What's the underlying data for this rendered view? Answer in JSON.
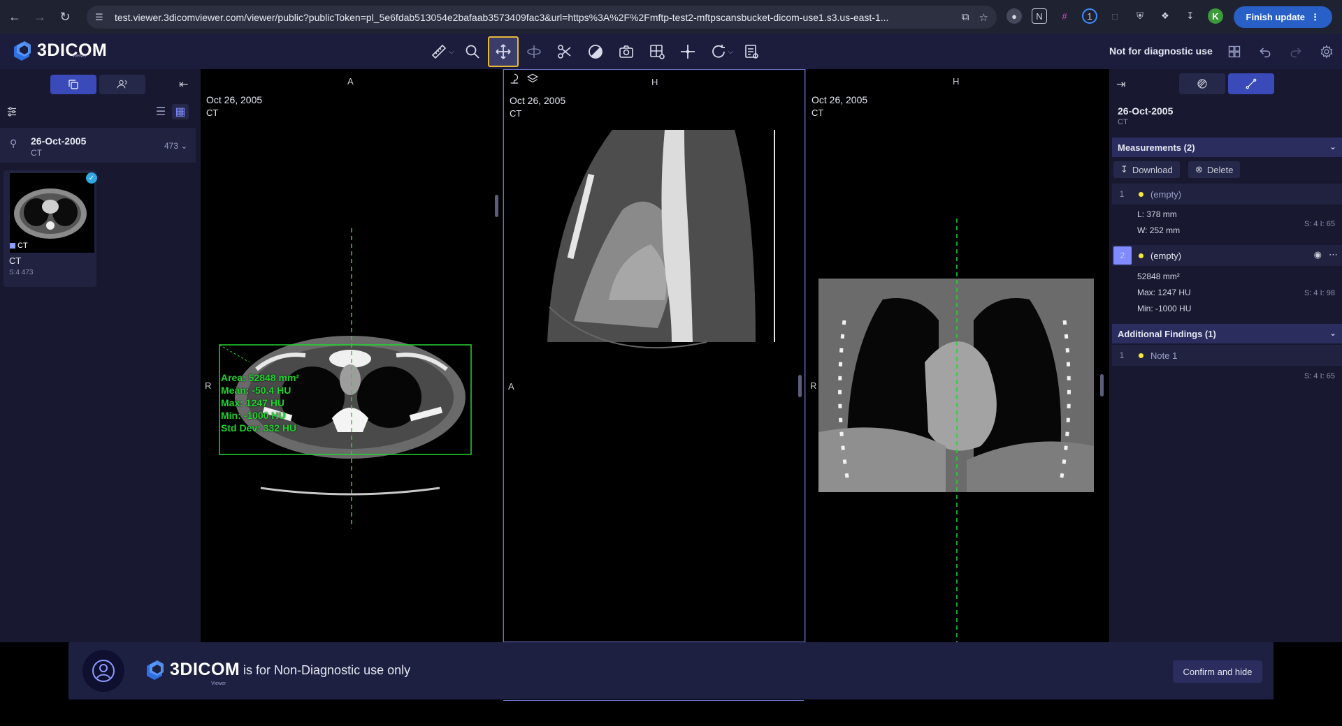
{
  "browser": {
    "url": "test.viewer.3dicomviewer.com/viewer/public?publicToken=pl_5e6fdab513054e2bafaab3573409fac3&url=https%3A%2F%2Fmftp-test2-mftpscansbucket-dicom-use1.s3.us-east-1...",
    "profile_initial": "K",
    "finish_update_label": "Finish update"
  },
  "app": {
    "logo_text": "3DICOM",
    "logo_sub": "Viewer",
    "diagnostic_notice": "Not for diagnostic use",
    "accent_color": "#3a4ab8",
    "active_tool": "pan-tool"
  },
  "left_panel": {
    "study": {
      "date": "26-Oct-2005",
      "modality": "CT",
      "count": "473"
    },
    "series": {
      "tag": "CT",
      "name": "CT",
      "meta": "S:4   473"
    }
  },
  "viewports": [
    {
      "orient_top": "A",
      "orient_left": "R",
      "date": "Oct 26, 2005",
      "modality": "CT",
      "roi": {
        "area": "Area: 52848 mm²",
        "mean": "Mean: -50.4 HU",
        "max": "Max: 1247 HU",
        "min": "Min: -1000 HU",
        "std": "Std Dev: 332 HU"
      }
    },
    {
      "orient_top": "H",
      "orient_left": "A",
      "date": "Oct 26, 2005",
      "modality": "CT"
    },
    {
      "orient_top": "H",
      "orient_left": "R",
      "date": "Oct 26, 2005",
      "modality": "CT"
    }
  ],
  "right_panel": {
    "date": "26-Oct-2005",
    "modality": "CT",
    "measurements_header": "Measurements (2)",
    "download_label": "Download",
    "delete_label": "Delete",
    "measurements": [
      {
        "index": "1",
        "name": "(empty)",
        "line1": "L: 378 mm",
        "line2": "W: 252 mm",
        "series": "S: 4 I: 65"
      },
      {
        "index": "2",
        "name": "(empty)",
        "line1": "52848 mm²",
        "line2": "Max: 1247 HU",
        "line3": "Min: -1000 HU",
        "series": "S: 4 I: 98"
      }
    ],
    "findings_header": "Additional Findings (1)",
    "findings": [
      {
        "index": "1",
        "name": "Note 1",
        "series": "S: 4 I: 65"
      }
    ]
  },
  "banner": {
    "logo_text": "3DICOM",
    "logo_sub": "Viewer",
    "message": "is for Non-Diagnostic use only",
    "confirm_label": "Confirm and hide"
  }
}
